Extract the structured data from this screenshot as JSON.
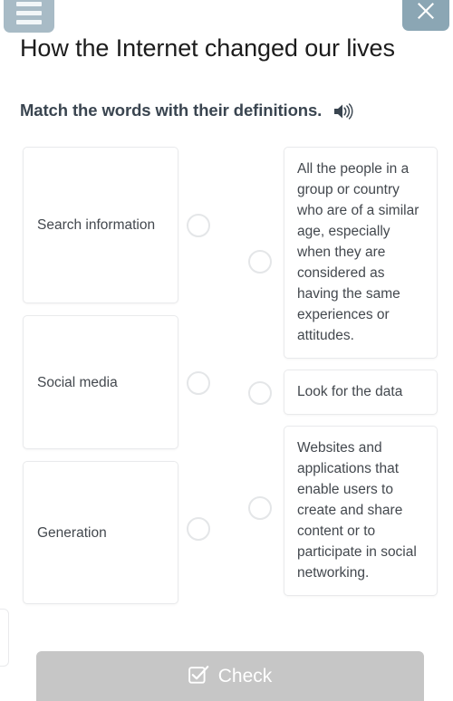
{
  "header": {
    "menu_icon": "hamburger-menu-icon",
    "close_icon": "close-x-icon",
    "menu_color": "#a8bbc6",
    "close_color": "#8ba6b4"
  },
  "lesson": {
    "title": "How the Internet changed our lives",
    "instruction": "Match the words with their definitions.",
    "audio_icon": "speaker-icon"
  },
  "exercise": {
    "type": "match-words-with-definitions",
    "words": [
      {
        "label": "Search information"
      },
      {
        "label": "Social media"
      },
      {
        "label": "Generation"
      }
    ],
    "definitions": [
      {
        "label": "All the people in a group or country who are of a similar age, especially when they are considered as having the same experiences or attitudes."
      },
      {
        "label": "Look for the data"
      },
      {
        "label": "Websites and applications that enable users to create and share content or to participate in social networking."
      }
    ]
  },
  "footer": {
    "check_label": "Check",
    "check_icon": "checkbox-checked-icon",
    "check_enabled": false,
    "check_color": "#c6c6c6"
  }
}
